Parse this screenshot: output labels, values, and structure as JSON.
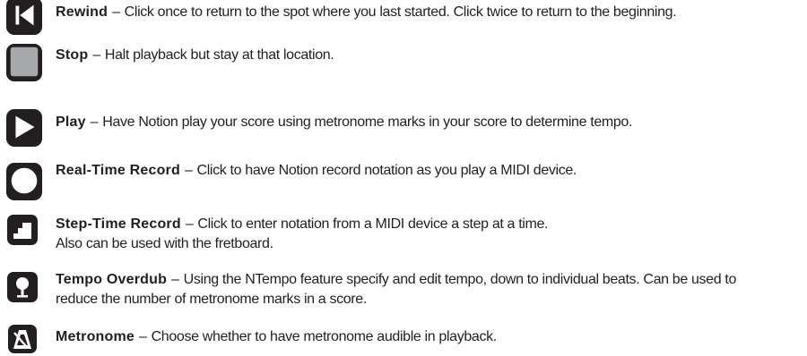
{
  "items": [
    {
      "name": "Rewind",
      "separator": "–",
      "description": "Click once to return to the spot where you last started. Click twice to return to the beginning.",
      "icon": "rewind-icon"
    },
    {
      "name": "Stop",
      "separator": "–",
      "description": "Halt playback but stay at that location.",
      "icon": "stop-icon"
    },
    {
      "name": "Play",
      "separator": "–",
      "description": "Have Notion play your score using metronome marks in your score to determine tempo.",
      "icon": "play-icon"
    },
    {
      "name": "Real-Time Record",
      "separator": "–",
      "description": "Click to have Notion record notation as you play a MIDI device.",
      "icon": "record-icon"
    },
    {
      "name": "Step-Time Record",
      "separator": "–",
      "description": "Click to enter notation from a MIDI device a step at a time.",
      "description_line2": "Also can be used with the fretboard.",
      "icon": "step-record-icon"
    },
    {
      "name": "Tempo Overdub",
      "separator": "–",
      "description": "Using the NTempo feature specify and edit tempo, down to individual beats. Can be used to",
      "description_line2": "reduce the number of metronome marks in a score.",
      "icon": "tempo-overdub-icon"
    },
    {
      "name": "Metronome",
      "separator": "–",
      "description": "Choose whether to have metronome audible in playback.",
      "icon": "metronome-icon"
    }
  ],
  "colors": {
    "text": "#231f20",
    "icon_background": "#231f20",
    "stop_fill": "#a7a9ac",
    "icon_glyph": "#ffffff"
  }
}
